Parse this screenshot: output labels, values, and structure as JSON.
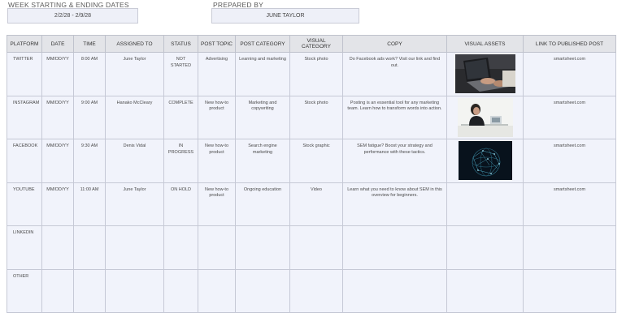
{
  "header": {
    "week_label": "WEEK STARTING & ENDING DATES",
    "week_value": "2/2/28 - 2/9/28",
    "prepared_label": "PREPARED BY",
    "prepared_value": "JUNE TAYLOR"
  },
  "columns": [
    "PLATFORM",
    "DATE",
    "TIME",
    "ASSIGNED TO",
    "STATUS",
    "POST TOPIC",
    "POST CATEGORY",
    "VISUAL CATEGORY",
    "COPY",
    "VISUAL ASSETS",
    "LINK TO PUBLISHED POST"
  ],
  "rows": [
    {
      "platform": "TWITTER",
      "date": "MM/DD/YY",
      "time": "8:00 AM",
      "assigned": "June Taylor",
      "status": "NOT STARTED",
      "topic": "Advertising",
      "category": "Learning and marketing",
      "visual_category": "Stock photo",
      "copy": "Do Facebook ads work? Visit our link and find out.",
      "asset": "laptop-hands-photo",
      "link": "smartsheet.com"
    },
    {
      "platform": "INSTAGRAM",
      "date": "MM/DD/YY",
      "time": "9:00 AM",
      "assigned": "Hanako McCleary",
      "status": "COMPLETE",
      "topic": "New how-to product",
      "category": "Marketing and copywriting",
      "visual_category": "Stock photo",
      "copy": "Posting is an essential tool for any marketing team. Learn how to transform words into action.",
      "asset": "woman-at-desk-photo",
      "link": "smartsheet.com"
    },
    {
      "platform": "FACEBOOK",
      "date": "MM/DD/YY",
      "time": "9:30 AM",
      "assigned": "Denis Vidal",
      "status": "IN PROGRESS",
      "topic": "New how-to product",
      "category": "Search engine marketing",
      "visual_category": "Stock graphic",
      "copy": "SEM fatigue? Boost your strategy and performance with these tactics.",
      "asset": "network-globe-graphic",
      "link": "smartsheet.com"
    },
    {
      "platform": "YOUTUBE",
      "date": "MM/DD/YY",
      "time": "11:00 AM",
      "assigned": "June Taylor",
      "status": "ON HOLD",
      "topic": "New how-to product",
      "category": "Ongoing education",
      "visual_category": "Video",
      "copy": "Learn what you need to know about SEM in this overview for beginners.",
      "asset": "",
      "link": "smartsheet.com"
    },
    {
      "platform": "LINKEDIN",
      "date": "",
      "time": "",
      "assigned": "",
      "status": "",
      "topic": "",
      "category": "",
      "visual_category": "",
      "copy": "",
      "asset": "",
      "link": ""
    },
    {
      "platform": "OTHER",
      "date": "",
      "time": "",
      "assigned": "",
      "status": "",
      "topic": "",
      "category": "",
      "visual_category": "",
      "copy": "",
      "asset": "",
      "link": ""
    }
  ]
}
